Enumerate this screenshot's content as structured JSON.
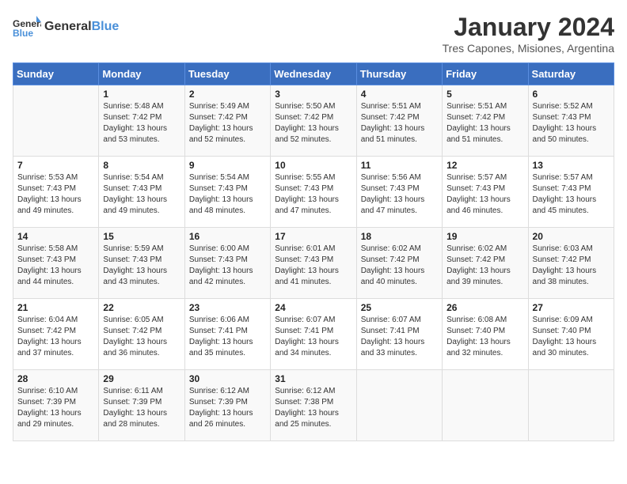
{
  "logo": {
    "general": "General",
    "blue": "Blue"
  },
  "title": "January 2024",
  "subtitle": "Tres Capones, Misiones, Argentina",
  "weekdays": [
    "Sunday",
    "Monday",
    "Tuesday",
    "Wednesday",
    "Thursday",
    "Friday",
    "Saturday"
  ],
  "weeks": [
    [
      {
        "day": "",
        "sunrise": "",
        "sunset": "",
        "daylight": ""
      },
      {
        "day": "1",
        "sunrise": "Sunrise: 5:48 AM",
        "sunset": "Sunset: 7:42 PM",
        "daylight": "Daylight: 13 hours and 53 minutes."
      },
      {
        "day": "2",
        "sunrise": "Sunrise: 5:49 AM",
        "sunset": "Sunset: 7:42 PM",
        "daylight": "Daylight: 13 hours and 52 minutes."
      },
      {
        "day": "3",
        "sunrise": "Sunrise: 5:50 AM",
        "sunset": "Sunset: 7:42 PM",
        "daylight": "Daylight: 13 hours and 52 minutes."
      },
      {
        "day": "4",
        "sunrise": "Sunrise: 5:51 AM",
        "sunset": "Sunset: 7:42 PM",
        "daylight": "Daylight: 13 hours and 51 minutes."
      },
      {
        "day": "5",
        "sunrise": "Sunrise: 5:51 AM",
        "sunset": "Sunset: 7:42 PM",
        "daylight": "Daylight: 13 hours and 51 minutes."
      },
      {
        "day": "6",
        "sunrise": "Sunrise: 5:52 AM",
        "sunset": "Sunset: 7:43 PM",
        "daylight": "Daylight: 13 hours and 50 minutes."
      }
    ],
    [
      {
        "day": "7",
        "sunrise": "Sunrise: 5:53 AM",
        "sunset": "Sunset: 7:43 PM",
        "daylight": "Daylight: 13 hours and 49 minutes."
      },
      {
        "day": "8",
        "sunrise": "Sunrise: 5:54 AM",
        "sunset": "Sunset: 7:43 PM",
        "daylight": "Daylight: 13 hours and 49 minutes."
      },
      {
        "day": "9",
        "sunrise": "Sunrise: 5:54 AM",
        "sunset": "Sunset: 7:43 PM",
        "daylight": "Daylight: 13 hours and 48 minutes."
      },
      {
        "day": "10",
        "sunrise": "Sunrise: 5:55 AM",
        "sunset": "Sunset: 7:43 PM",
        "daylight": "Daylight: 13 hours and 47 minutes."
      },
      {
        "day": "11",
        "sunrise": "Sunrise: 5:56 AM",
        "sunset": "Sunset: 7:43 PM",
        "daylight": "Daylight: 13 hours and 47 minutes."
      },
      {
        "day": "12",
        "sunrise": "Sunrise: 5:57 AM",
        "sunset": "Sunset: 7:43 PM",
        "daylight": "Daylight: 13 hours and 46 minutes."
      },
      {
        "day": "13",
        "sunrise": "Sunrise: 5:57 AM",
        "sunset": "Sunset: 7:43 PM",
        "daylight": "Daylight: 13 hours and 45 minutes."
      }
    ],
    [
      {
        "day": "14",
        "sunrise": "Sunrise: 5:58 AM",
        "sunset": "Sunset: 7:43 PM",
        "daylight": "Daylight: 13 hours and 44 minutes."
      },
      {
        "day": "15",
        "sunrise": "Sunrise: 5:59 AM",
        "sunset": "Sunset: 7:43 PM",
        "daylight": "Daylight: 13 hours and 43 minutes."
      },
      {
        "day": "16",
        "sunrise": "Sunrise: 6:00 AM",
        "sunset": "Sunset: 7:43 PM",
        "daylight": "Daylight: 13 hours and 42 minutes."
      },
      {
        "day": "17",
        "sunrise": "Sunrise: 6:01 AM",
        "sunset": "Sunset: 7:43 PM",
        "daylight": "Daylight: 13 hours and 41 minutes."
      },
      {
        "day": "18",
        "sunrise": "Sunrise: 6:02 AM",
        "sunset": "Sunset: 7:42 PM",
        "daylight": "Daylight: 13 hours and 40 minutes."
      },
      {
        "day": "19",
        "sunrise": "Sunrise: 6:02 AM",
        "sunset": "Sunset: 7:42 PM",
        "daylight": "Daylight: 13 hours and 39 minutes."
      },
      {
        "day": "20",
        "sunrise": "Sunrise: 6:03 AM",
        "sunset": "Sunset: 7:42 PM",
        "daylight": "Daylight: 13 hours and 38 minutes."
      }
    ],
    [
      {
        "day": "21",
        "sunrise": "Sunrise: 6:04 AM",
        "sunset": "Sunset: 7:42 PM",
        "daylight": "Daylight: 13 hours and 37 minutes."
      },
      {
        "day": "22",
        "sunrise": "Sunrise: 6:05 AM",
        "sunset": "Sunset: 7:42 PM",
        "daylight": "Daylight: 13 hours and 36 minutes."
      },
      {
        "day": "23",
        "sunrise": "Sunrise: 6:06 AM",
        "sunset": "Sunset: 7:41 PM",
        "daylight": "Daylight: 13 hours and 35 minutes."
      },
      {
        "day": "24",
        "sunrise": "Sunrise: 6:07 AM",
        "sunset": "Sunset: 7:41 PM",
        "daylight": "Daylight: 13 hours and 34 minutes."
      },
      {
        "day": "25",
        "sunrise": "Sunrise: 6:07 AM",
        "sunset": "Sunset: 7:41 PM",
        "daylight": "Daylight: 13 hours and 33 minutes."
      },
      {
        "day": "26",
        "sunrise": "Sunrise: 6:08 AM",
        "sunset": "Sunset: 7:40 PM",
        "daylight": "Daylight: 13 hours and 32 minutes."
      },
      {
        "day": "27",
        "sunrise": "Sunrise: 6:09 AM",
        "sunset": "Sunset: 7:40 PM",
        "daylight": "Daylight: 13 hours and 30 minutes."
      }
    ],
    [
      {
        "day": "28",
        "sunrise": "Sunrise: 6:10 AM",
        "sunset": "Sunset: 7:39 PM",
        "daylight": "Daylight: 13 hours and 29 minutes."
      },
      {
        "day": "29",
        "sunrise": "Sunrise: 6:11 AM",
        "sunset": "Sunset: 7:39 PM",
        "daylight": "Daylight: 13 hours and 28 minutes."
      },
      {
        "day": "30",
        "sunrise": "Sunrise: 6:12 AM",
        "sunset": "Sunset: 7:39 PM",
        "daylight": "Daylight: 13 hours and 26 minutes."
      },
      {
        "day": "31",
        "sunrise": "Sunrise: 6:12 AM",
        "sunset": "Sunset: 7:38 PM",
        "daylight": "Daylight: 13 hours and 25 minutes."
      },
      {
        "day": "",
        "sunrise": "",
        "sunset": "",
        "daylight": ""
      },
      {
        "day": "",
        "sunrise": "",
        "sunset": "",
        "daylight": ""
      },
      {
        "day": "",
        "sunrise": "",
        "sunset": "",
        "daylight": ""
      }
    ]
  ]
}
